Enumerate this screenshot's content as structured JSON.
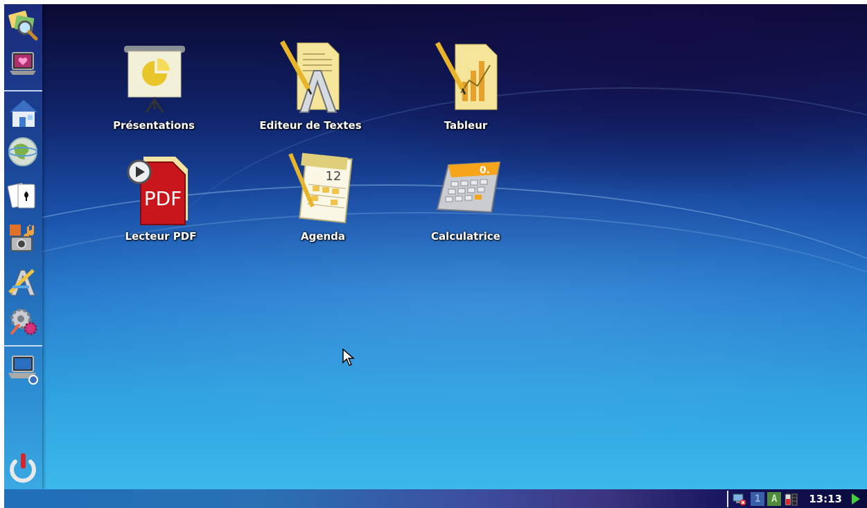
{
  "desktop": {
    "apps": [
      {
        "id": "presentations",
        "label": "Présentations",
        "icon": "presentation-icon"
      },
      {
        "id": "text-editor",
        "label": "Editeur de Textes",
        "icon": "text-editor-icon"
      },
      {
        "id": "spreadsheet",
        "label": "Tableur",
        "icon": "spreadsheet-icon"
      },
      {
        "id": "pdf-reader",
        "label": "Lecteur PDF",
        "icon": "pdf-reader-icon"
      },
      {
        "id": "agenda",
        "label": "Agenda",
        "icon": "calendar-icon"
      },
      {
        "id": "calculator",
        "label": "Calculatrice",
        "icon": "calculator-icon"
      }
    ],
    "icon_text": {
      "pdf": "PDF",
      "calendar_day": "12",
      "calculator_display": "0."
    }
  },
  "launcher": {
    "items": [
      {
        "icon": "search-files-icon"
      },
      {
        "icon": "favorites-laptop-icon"
      },
      {
        "icon": "home-icon"
      },
      {
        "icon": "internet-globe-icon"
      },
      {
        "icon": "games-cards-icon"
      },
      {
        "icon": "multimedia-icon"
      },
      {
        "icon": "office-icon"
      },
      {
        "icon": "settings-icon"
      },
      {
        "icon": "computer-icon"
      },
      {
        "icon": "power-icon"
      }
    ]
  },
  "taskbar": {
    "workspaces": [
      "1",
      "A"
    ],
    "clock": "13:13",
    "tray_icons": [
      "network-disconnected-icon",
      "battery-icon",
      "show-desktop-icon"
    ]
  },
  "colors": {
    "accent_green": "#3fcf3f",
    "pdf_red": "#c8161c",
    "calc_orange": "#f6a51a"
  }
}
